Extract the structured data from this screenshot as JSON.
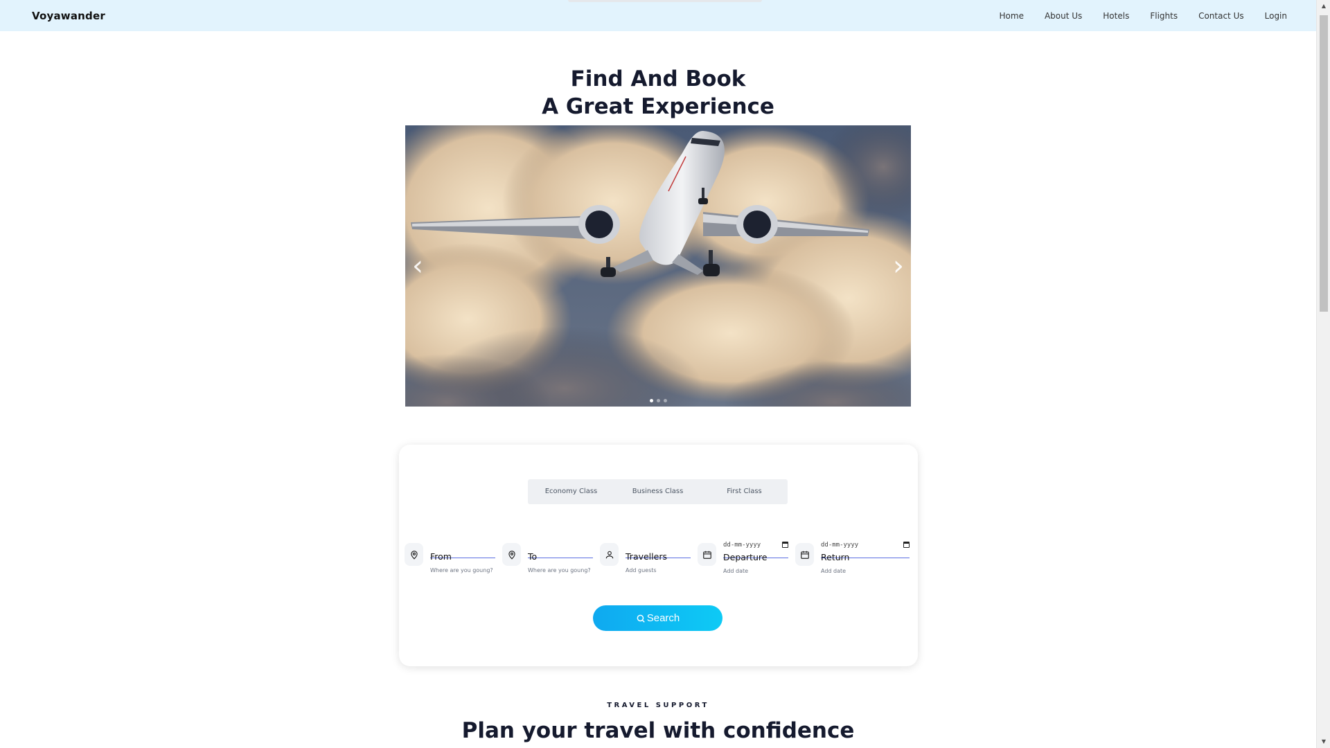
{
  "navbar": {
    "brand": "Voyawander",
    "links": [
      "Home",
      "About Us",
      "Hotels",
      "Flights",
      "Contact Us",
      "Login"
    ]
  },
  "hero": {
    "title_line1": "Find And Book",
    "title_line2": "A Great Experience",
    "carousel": {
      "slide_count": 3,
      "active_slide": 1,
      "image": "airplane-in-clouds"
    }
  },
  "booking": {
    "class_tabs": [
      "Economy Class",
      "Business Class",
      "First Class"
    ],
    "fields": [
      {
        "label": "From",
        "sub": "Where are you goung?",
        "icon": "map-pin-icon"
      },
      {
        "label": "To",
        "sub": "Where are you goung?",
        "icon": "map-pin-icon"
      },
      {
        "label": "Travellers",
        "sub": "Add guests",
        "icon": "user-icon"
      },
      {
        "label": "Departure",
        "sub": "Add date",
        "icon": "calendar-icon",
        "date_placeholder": "dd-mm-yyyy"
      },
      {
        "label": "Return",
        "sub": "Add date",
        "icon": "calendar-icon",
        "date_placeholder": "dd-mm-yyyy"
      }
    ],
    "search_label": "Search"
  },
  "support": {
    "eyebrow": "TRAVEL SUPPORT",
    "title": "Plan your travel with confidence"
  },
  "colors": {
    "navbar_bg": "#e2f3fd",
    "accent_start": "#0fa9f0",
    "accent_end": "#0ecaf5",
    "heading": "#151a2e"
  }
}
